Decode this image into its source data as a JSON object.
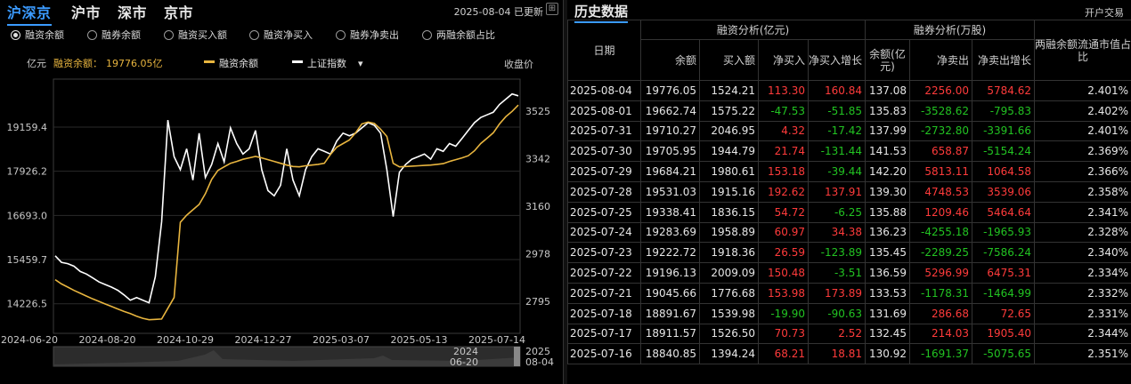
{
  "tabs": [
    "沪深京",
    "沪市",
    "深市",
    "京市"
  ],
  "update_text": "2025-08-04 已更新",
  "radio_options": [
    "融资余额",
    "融券余额",
    "融资买入额",
    "融资净买入",
    "融券净卖出",
    "两融余额占比"
  ],
  "legend": {
    "unit": "亿元",
    "current_label": "融资余额：",
    "current_value": "19776.05亿",
    "series1": "融资余额",
    "series2": "上证指数",
    "right_label": "收盘价"
  },
  "slider": {
    "start_year": "2024",
    "start_date": "06-20",
    "end_year": "2025",
    "end_date": "08-04"
  },
  "colors": {
    "series1": "#e8b53f",
    "series2": "#ffffff",
    "accent": "#3b9bff",
    "up": "#ff3b3b",
    "down": "#22c322"
  },
  "chart_data": {
    "type": "line",
    "x_ticks": [
      "2024-06-20",
      "2024-08-20",
      "2024-10-29",
      "2024-12-27",
      "2025-03-07",
      "2025-05-13",
      "2025-07-14"
    ],
    "y_left_ticks": [
      "19159.4",
      "17926.2",
      "16693.0",
      "15459.7",
      "14226.5"
    ],
    "y_right_ticks": [
      "3525",
      "3342",
      "3160",
      "2978",
      "2795"
    ],
    "y_left_range": [
      13400,
      20500
    ],
    "y_right_range": [
      2673,
      3647
    ],
    "series": [
      {
        "name": "融资余额",
        "axis": "left",
        "values": [
          14900,
          14780,
          14690,
          14600,
          14520,
          14440,
          14360,
          14290,
          14220,
          14150,
          14080,
          14010,
          13950,
          13880,
          13820,
          13780,
          13790,
          13800,
          14100,
          14400,
          16500,
          16700,
          16850,
          17000,
          17300,
          17700,
          17950,
          18050,
          18150,
          18200,
          18260,
          18300,
          18340,
          18300,
          18250,
          18200,
          18150,
          18100,
          18060,
          18050,
          18080,
          18100,
          18120,
          18150,
          18400,
          18600,
          18700,
          18800,
          19000,
          19250,
          19300,
          19260,
          19100,
          18900,
          18150,
          18050,
          18060,
          18070,
          18080,
          18090,
          18100,
          18120,
          18140,
          18200,
          18250,
          18300,
          18360,
          18500,
          18700,
          18850,
          19000,
          19250,
          19450,
          19600,
          19776
        ]
      },
      {
        "name": "上证指数",
        "axis": "right",
        "values": [
          2970,
          2945,
          2940,
          2930,
          2910,
          2900,
          2885,
          2870,
          2860,
          2850,
          2838,
          2820,
          2800,
          2810,
          2800,
          2790,
          2890,
          3100,
          3490,
          3350,
          3300,
          3380,
          3260,
          3440,
          3270,
          3320,
          3400,
          3330,
          3460,
          3400,
          3360,
          3380,
          3450,
          3300,
          3220,
          3200,
          3240,
          3380,
          3260,
          3200,
          3300,
          3350,
          3380,
          3370,
          3360,
          3410,
          3440,
          3430,
          3440,
          3460,
          3480,
          3470,
          3440,
          3300,
          3120,
          3290,
          3320,
          3340,
          3350,
          3360,
          3340,
          3380,
          3370,
          3400,
          3390,
          3420,
          3450,
          3480,
          3500,
          3510,
          3520,
          3550,
          3570,
          3590,
          3583
        ]
      }
    ]
  },
  "table": {
    "title": "历史数据",
    "open_account": "开户交易",
    "header": {
      "date": "日期",
      "margin_group": "融资分析(亿元)",
      "short_group": "融券分析(万股)",
      "margin_cols": [
        "余额",
        "买入额",
        "净买入",
        "净买入增长"
      ],
      "short_cols": [
        "余额(亿元)",
        "净卖出",
        "净卖出增长"
      ],
      "ratio_col": "两融余额流通市值占比"
    },
    "rows": [
      [
        "2025-08-04",
        "19776.05",
        "1524.21",
        "113.30",
        "160.84",
        "137.08",
        "2256.00",
        "5784.62",
        "2.401%"
      ],
      [
        "2025-08-01",
        "19662.74",
        "1575.22",
        "-47.53",
        "-51.85",
        "135.83",
        "-3528.62",
        "-795.83",
        "2.402%"
      ],
      [
        "2025-07-31",
        "19710.27",
        "2046.95",
        "4.32",
        "-17.42",
        "137.99",
        "-2732.80",
        "-3391.66",
        "2.401%"
      ],
      [
        "2025-07-30",
        "19705.95",
        "1944.79",
        "21.74",
        "-131.44",
        "141.53",
        "658.87",
        "-5154.24",
        "2.369%"
      ],
      [
        "2025-07-29",
        "19684.21",
        "1980.61",
        "153.18",
        "-39.44",
        "142.20",
        "5813.11",
        "1064.58",
        "2.366%"
      ],
      [
        "2025-07-28",
        "19531.03",
        "1915.16",
        "192.62",
        "137.91",
        "139.30",
        "4748.53",
        "3539.06",
        "2.358%"
      ],
      [
        "2025-07-25",
        "19338.41",
        "1836.15",
        "54.72",
        "-6.25",
        "135.88",
        "1209.46",
        "5464.64",
        "2.341%"
      ],
      [
        "2025-07-24",
        "19283.69",
        "1958.89",
        "60.97",
        "34.38",
        "136.23",
        "-4255.18",
        "-1965.93",
        "2.328%"
      ],
      [
        "2025-07-23",
        "19222.72",
        "1918.36",
        "26.59",
        "-123.89",
        "135.45",
        "-2289.25",
        "-7586.24",
        "2.340%"
      ],
      [
        "2025-07-22",
        "19196.13",
        "2009.09",
        "150.48",
        "-3.51",
        "136.59",
        "5296.99",
        "6475.31",
        "2.334%"
      ],
      [
        "2025-07-21",
        "19045.66",
        "1776.68",
        "153.98",
        "173.89",
        "133.53",
        "-1178.31",
        "-1464.99",
        "2.332%"
      ],
      [
        "2025-07-18",
        "18891.67",
        "1539.98",
        "-19.90",
        "-90.63",
        "131.69",
        "286.68",
        "72.65",
        "2.331%"
      ],
      [
        "2025-07-17",
        "18911.57",
        "1526.50",
        "70.73",
        "2.52",
        "132.45",
        "214.03",
        "1905.40",
        "2.344%"
      ],
      [
        "2025-07-16",
        "18840.85",
        "1394.24",
        "68.21",
        "18.81",
        "130.92",
        "-1691.37",
        "-5075.65",
        "2.351%"
      ]
    ]
  }
}
